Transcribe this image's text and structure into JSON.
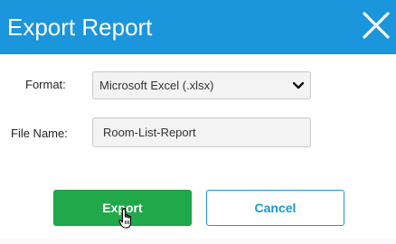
{
  "dialog": {
    "title": "Export Report",
    "close_icon": "close-icon",
    "header_color": "#1b95dc"
  },
  "form": {
    "format_label": "Format:",
    "format_value": "Microsoft Excel (.xlsx)",
    "format_chevron_icon": "chevron-down-icon",
    "filename_label": "File Name:",
    "filename_value": "Room-List-Report"
  },
  "actions": {
    "export_label": "Export",
    "cancel_label": "Cancel",
    "export_color": "#21a84b",
    "cancel_color": "#1b95dc"
  },
  "cursor_icon": "hand-pointer-icon"
}
